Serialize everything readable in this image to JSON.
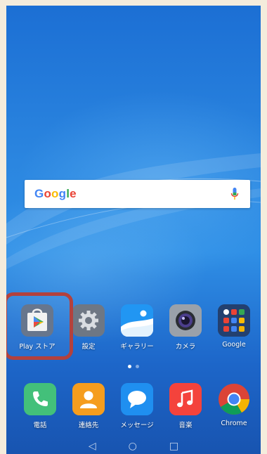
{
  "search": {
    "logo": "Google"
  },
  "home_row": [
    {
      "label": "Play ストア",
      "icon": "play-store-icon"
    },
    {
      "label": "設定",
      "icon": "settings-icon"
    },
    {
      "label": "ギャラリー",
      "icon": "gallery-icon"
    },
    {
      "label": "カメラ",
      "icon": "camera-icon"
    },
    {
      "label": "Google",
      "icon": "google-folder-icon"
    }
  ],
  "dock": [
    {
      "label": "電話",
      "icon": "phone-icon"
    },
    {
      "label": "連絡先",
      "icon": "contacts-icon"
    },
    {
      "label": "メッセージ",
      "icon": "messages-icon"
    },
    {
      "label": "音楽",
      "icon": "music-icon"
    },
    {
      "label": "Chrome",
      "icon": "chrome-icon"
    }
  ],
  "page_indicator": {
    "count": 2,
    "active": 1
  },
  "nav": {
    "back": "◁",
    "home": "○",
    "recents": "□"
  },
  "colors": {
    "highlight": "#b3413d",
    "google_blue": "#4285f4"
  }
}
